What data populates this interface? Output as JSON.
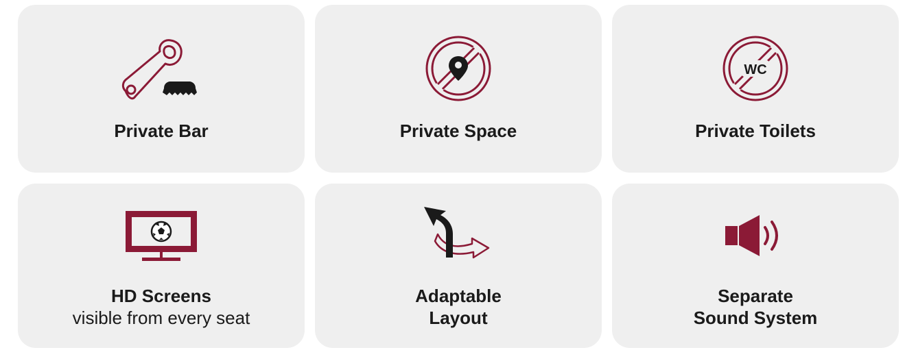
{
  "colors": {
    "accent": "#8b1a36",
    "card_bg": "#efefef",
    "text": "#1a1a1a"
  },
  "features": [
    {
      "icon": "bottle-opener-icon",
      "title": "Private Bar",
      "subtitle": ""
    },
    {
      "icon": "location-pin-icon",
      "title": "Private Space",
      "subtitle": ""
    },
    {
      "icon": "wc-icon",
      "title": "Private Toilets",
      "subtitle": "",
      "icon_text": "WC"
    },
    {
      "icon": "tv-football-icon",
      "title": "HD Screens",
      "subtitle": "visible from every seat"
    },
    {
      "icon": "curved-arrows-icon",
      "title": "Adaptable",
      "subtitle": "Layout"
    },
    {
      "icon": "speaker-icon",
      "title": "Separate",
      "subtitle": "Sound System"
    }
  ]
}
